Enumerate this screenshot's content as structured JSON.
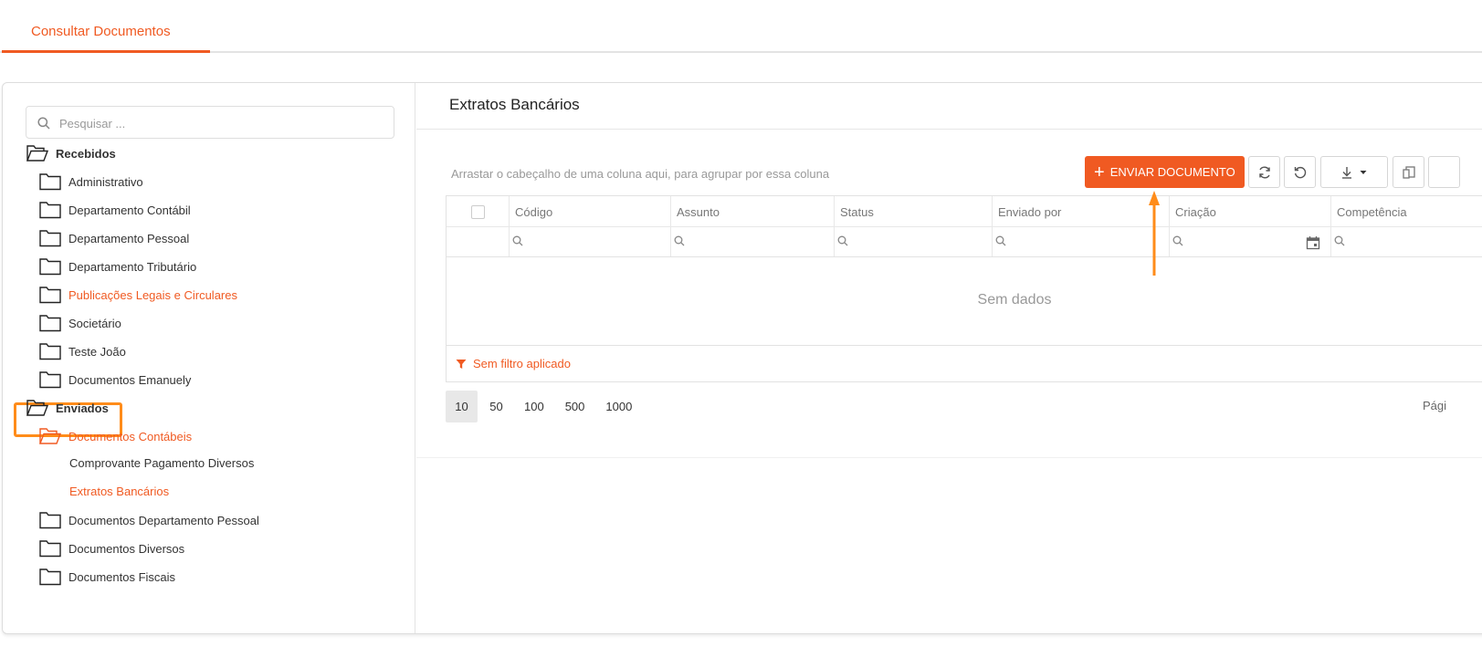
{
  "tabs": [
    {
      "label": "Consultar Documentos",
      "active": true
    }
  ],
  "search": {
    "placeholder": "Pesquisar ..."
  },
  "tree": {
    "received": {
      "label": "Recebidos",
      "children": [
        "Administrativo",
        "Departamento Contábil",
        "Departamento Pessoal",
        "Departamento Tributário",
        "Publicações Legais e Circulares",
        "Societário",
        "Teste João",
        "Documentos Emanuely"
      ]
    },
    "sent": {
      "label": "Enviados",
      "accounting": {
        "label": "Documentos Contábeis",
        "children": [
          "Comprovante Pagamento Diversos",
          "Extratos Bancários"
        ]
      },
      "others": [
        "Documentos Departamento Pessoal",
        "Documentos Diversos",
        "Documentos Fiscais"
      ]
    }
  },
  "content": {
    "title": "Extratos Bancários",
    "group_hint": "Arrastar o cabeçalho de uma coluna aqui, para agrupar por essa coluna",
    "send_button": "ENVIAR DOCUMENTO",
    "columns": [
      "Código",
      "Assunto",
      "Status",
      "Enviado por",
      "Criação",
      "Competência"
    ],
    "no_data": "Sem dados",
    "filter_status": "Sem filtro aplicado",
    "page_sizes": [
      "10",
      "50",
      "100",
      "500",
      "1000"
    ],
    "page_size_selected": "10",
    "page_info": "Pági"
  },
  "colors": {
    "accent": "#f05a22",
    "highlight": "#ff8c1a"
  }
}
